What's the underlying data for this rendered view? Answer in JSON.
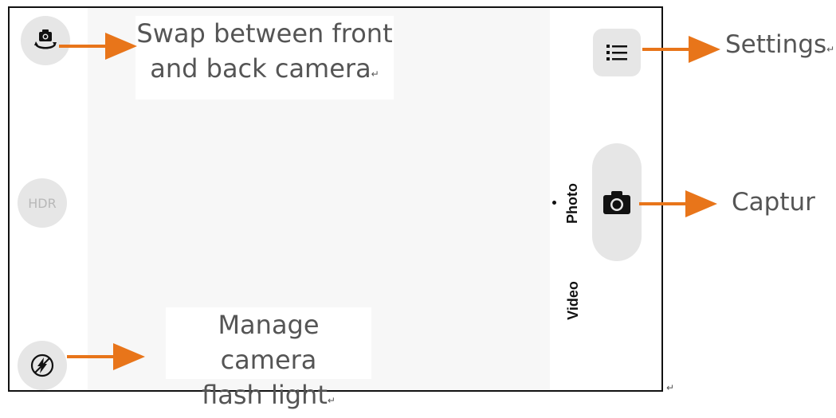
{
  "camera": {
    "hdr_label": "HDR",
    "modes": {
      "photo": "Photo",
      "video": "Video",
      "selected": "Photo"
    }
  },
  "annotations": {
    "swap_line1": "Swap between front",
    "swap_line2": "and back camera",
    "flash_line1": "Manage camera",
    "flash_line2": "flash light",
    "settings": "Settings",
    "capture": "Captur",
    "return_mark": "↵"
  },
  "colors": {
    "arrow": "#E8751A",
    "button_bg": "#e6e6e6",
    "text": "#555555"
  },
  "icons": {
    "swap": "camera-swap-icon",
    "flash": "flash-off-icon",
    "settings": "list-icon",
    "capture": "camera-icon"
  }
}
